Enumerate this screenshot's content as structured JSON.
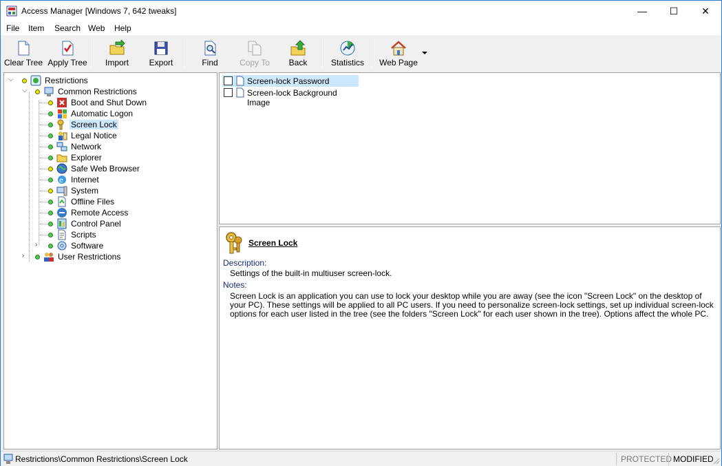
{
  "window": {
    "title": "Access Manager [Windows 7, 642 tweaks]",
    "minimize_symbol": "—",
    "maximize_symbol": "☐",
    "close_symbol": "✕"
  },
  "menu": [
    "File",
    "Item",
    "Search",
    "Web",
    "Help"
  ],
  "toolbar": {
    "clear_tree": "Clear Tree",
    "apply_tree": "Apply Tree",
    "import": "Import",
    "export": "Export",
    "find": "Find",
    "copy_to": "Copy To",
    "back": "Back",
    "statistics": "Statistics",
    "web_page": "Web Page"
  },
  "tree": {
    "root": "Restrictions",
    "common": "Common Restrictions",
    "items": [
      "Boot and Shut Down",
      "Automatic Logon",
      "Screen Lock",
      "Legal Notice",
      "Network",
      "Explorer",
      "Safe Web Browser",
      "Internet",
      "System",
      "Offline Files",
      "Remote Access",
      "Control Panel",
      "Scripts",
      "Software"
    ],
    "user": "User Restrictions",
    "selected": "Screen Lock"
  },
  "list": {
    "items": [
      "Screen-lock Password",
      "Screen-lock Background Image"
    ]
  },
  "description": {
    "title": "Screen Lock",
    "description_label": "Description:",
    "description_text": "Settings of the built-in multiuser screen-lock.",
    "notes_label": "Notes:",
    "notes_text": "Screen Lock is an application you can use to lock your desktop while you are away (see the icon \"Screen Lock\" on the desktop of your PC). These settings will be applied to all PC users. If you need to personalize screen-lock settings, set up individual screen-lock options for each user listed in the tree (see the folders \"Screen Lock\" for each user shown in the tree). Options affect the whole PC."
  },
  "status": {
    "path": "Restrictions\\Common Restrictions\\Screen Lock",
    "protected": "PROTECTED",
    "modified": "MODIFIED"
  },
  "colors": {
    "selection": "#cce8ff",
    "window_border": "#2b79d6",
    "status_yellow": "#e8e800",
    "status_green": "#4ec94e"
  },
  "icons": {
    "app": "access-manager-icon",
    "clear_tree": "blank-page-icon",
    "apply_tree": "checked-page-icon",
    "import": "folder-import-icon",
    "export": "floppy-disk-icon",
    "find": "magnifier-page-icon",
    "copy_to": "copy-pages-icon",
    "back": "folder-back-icon",
    "statistics": "chart-icon",
    "web_page": "house-icon"
  }
}
